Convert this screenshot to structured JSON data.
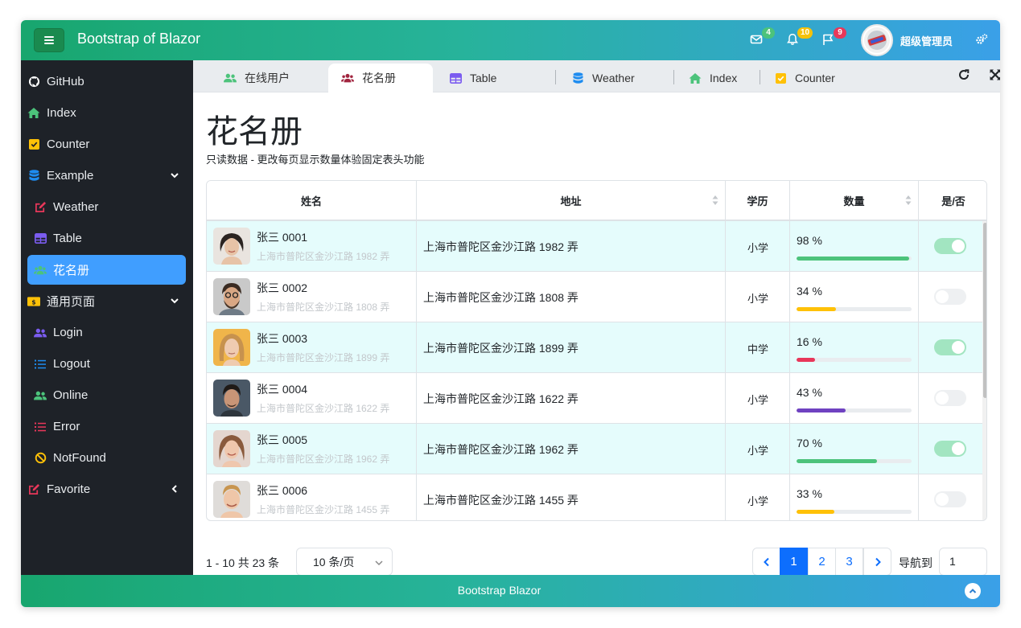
{
  "header": {
    "brand": "Bootstrap of Blazor",
    "mail_badge": "4",
    "bell_badge": "10",
    "flag_badge": "9",
    "user_name": "超级管理员",
    "colors": {
      "mail_badge": "#4cc37b",
      "bell_badge": "#f5c20a",
      "flag_badge": "#e8375a"
    }
  },
  "sidebar": {
    "items": [
      {
        "label": "GitHub",
        "icon": "github-icon"
      },
      {
        "label": "Index",
        "icon": "home-icon"
      },
      {
        "label": "Counter",
        "icon": "checkbox-icon"
      },
      {
        "label": "Example",
        "icon": "database-icon"
      },
      {
        "label": "Weather",
        "icon": "edit-icon"
      },
      {
        "label": "Table",
        "icon": "table-icon"
      },
      {
        "label": "花名册",
        "icon": "users-icon"
      },
      {
        "label": "通用页面",
        "icon": "money-icon"
      },
      {
        "label": "Login",
        "icon": "user-group-icon"
      },
      {
        "label": "Logout",
        "icon": "list-icon"
      },
      {
        "label": "Online",
        "icon": "users-icon"
      },
      {
        "label": "Error",
        "icon": "list-icon"
      },
      {
        "label": "NotFound",
        "icon": "ban-icon"
      },
      {
        "label": "Favorite",
        "icon": "edit-icon"
      }
    ]
  },
  "tabs": [
    {
      "label": "在线用户"
    },
    {
      "label": "花名册"
    },
    {
      "label": "Table"
    },
    {
      "label": "Weather"
    },
    {
      "label": "Index"
    },
    {
      "label": "Counter"
    }
  ],
  "page": {
    "title": "花名册",
    "subtitle": "只读数据 - 更改每页显示数量体验固定表头功能"
  },
  "table": {
    "columns": [
      "姓名",
      "地址",
      "学历",
      "数量",
      "是/否"
    ],
    "rows": [
      {
        "name": "张三 0001",
        "sub_addr": "上海市普陀区金沙江路 1982 弄",
        "address": "上海市普陀区金沙江路 1982 弄",
        "edu": "小学",
        "pct_label": "98 %",
        "pct": 98,
        "bar_color": "#4cc37b",
        "on": true
      },
      {
        "name": "张三 0002",
        "sub_addr": "上海市普陀区金沙江路 1808 弄",
        "address": "上海市普陀区金沙江路 1808 弄",
        "edu": "小学",
        "pct_label": "34 %",
        "pct": 34,
        "bar_color": "#ffc107",
        "on": false
      },
      {
        "name": "张三 0003",
        "sub_addr": "上海市普陀区金沙江路 1899 弄",
        "address": "上海市普陀区金沙江路 1899 弄",
        "edu": "中学",
        "pct_label": "16 %",
        "pct": 16,
        "bar_color": "#e8375a",
        "on": true
      },
      {
        "name": "张三 0004",
        "sub_addr": "上海市普陀区金沙江路 1622 弄",
        "address": "上海市普陀区金沙江路 1622 弄",
        "edu": "小学",
        "pct_label": "43 %",
        "pct": 43,
        "bar_color": "#6f42c1",
        "on": false
      },
      {
        "name": "张三 0005",
        "sub_addr": "上海市普陀区金沙江路 1962 弄",
        "address": "上海市普陀区金沙江路 1962 弄",
        "edu": "小学",
        "pct_label": "70 %",
        "pct": 70,
        "bar_color": "#4cc37b",
        "on": true
      },
      {
        "name": "张三 0006",
        "sub_addr": "上海市普陀区金沙江路 1455 弄",
        "address": "上海市普陀区金沙江路 1455 弄",
        "edu": "小学",
        "pct_label": "33 %",
        "pct": 33,
        "bar_color": "#ffc107",
        "on": false
      }
    ]
  },
  "pager": {
    "info": "1 - 10 共 23 条",
    "page_size": "10 条/页",
    "pages": [
      "1",
      "2",
      "3"
    ],
    "goto_label": "导航到",
    "goto_value": "1"
  },
  "footer": {
    "text": "Bootstrap Blazor"
  }
}
